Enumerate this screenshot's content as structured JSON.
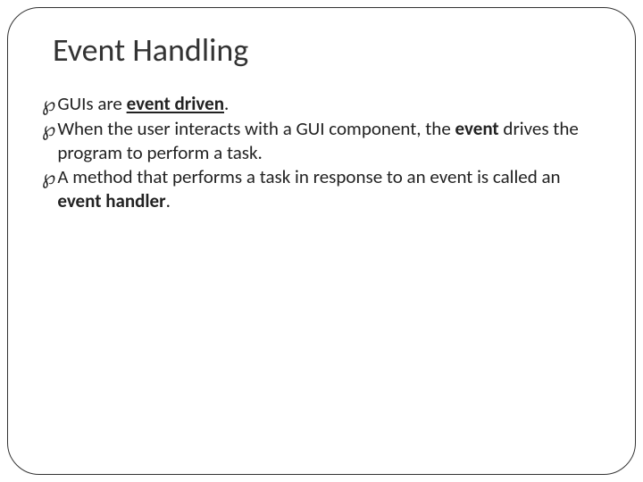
{
  "slide": {
    "title": "Event Handling",
    "bullets": [
      {
        "segments": [
          {
            "text": "GUIs are ",
            "bold": false,
            "underline": false
          },
          {
            "text": "event driven",
            "bold": true,
            "underline": true
          },
          {
            "text": ".",
            "bold": false,
            "underline": false
          }
        ]
      },
      {
        "segments": [
          {
            "text": "When the user interacts with a GUI component, the ",
            "bold": false,
            "underline": false
          },
          {
            "text": "event",
            "bold": true,
            "underline": false
          },
          {
            "text": " drives the program to perform a task.",
            "bold": false,
            "underline": false
          }
        ]
      },
      {
        "segments": [
          {
            "text": "A method that performs a task in response to an event is called an ",
            "bold": false,
            "underline": false
          },
          {
            "text": "event handler",
            "bold": true,
            "underline": false
          },
          {
            "text": ".",
            "bold": false,
            "underline": false
          }
        ]
      }
    ],
    "bullet_marker": "ག"
  }
}
